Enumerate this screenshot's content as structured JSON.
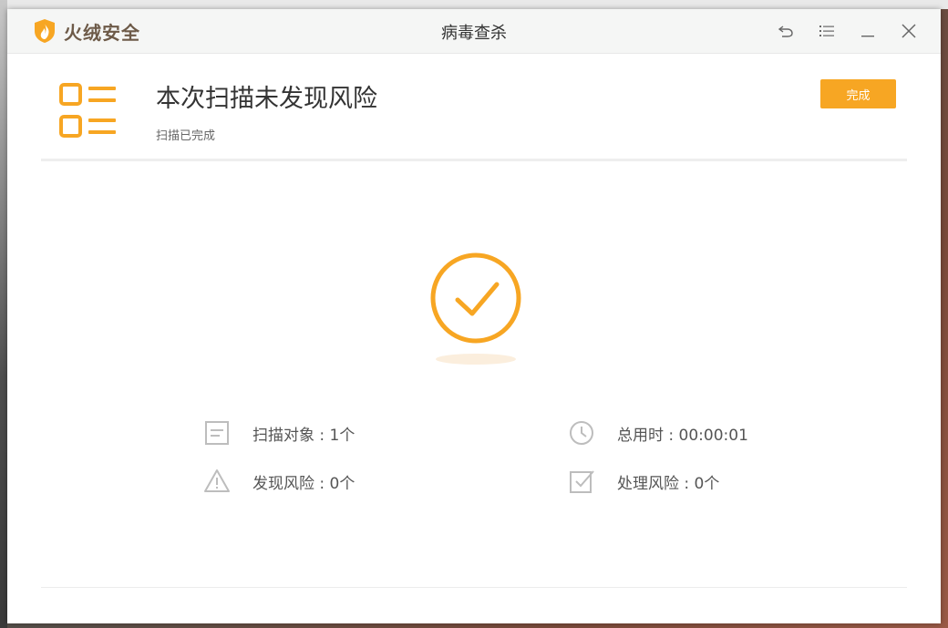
{
  "app": {
    "brand_name": "火绒安全",
    "window_title": "病毒查杀",
    "accent_color": "#f7a623",
    "brand_color": "#6d5a48"
  },
  "titlebar": {
    "buttons": [
      "back-icon",
      "menu-icon",
      "minimize-icon",
      "close-icon"
    ]
  },
  "result": {
    "title": "本次扫描未发现风险",
    "subtitle": "扫描已完成",
    "done_label": "完成"
  },
  "stats": {
    "scan_objects": "扫描对象 : 1个",
    "total_time": "总用时 : 00:00:01",
    "risks_found": "发现风险 : 0个",
    "risks_handled": "处理风险 : 0个"
  }
}
